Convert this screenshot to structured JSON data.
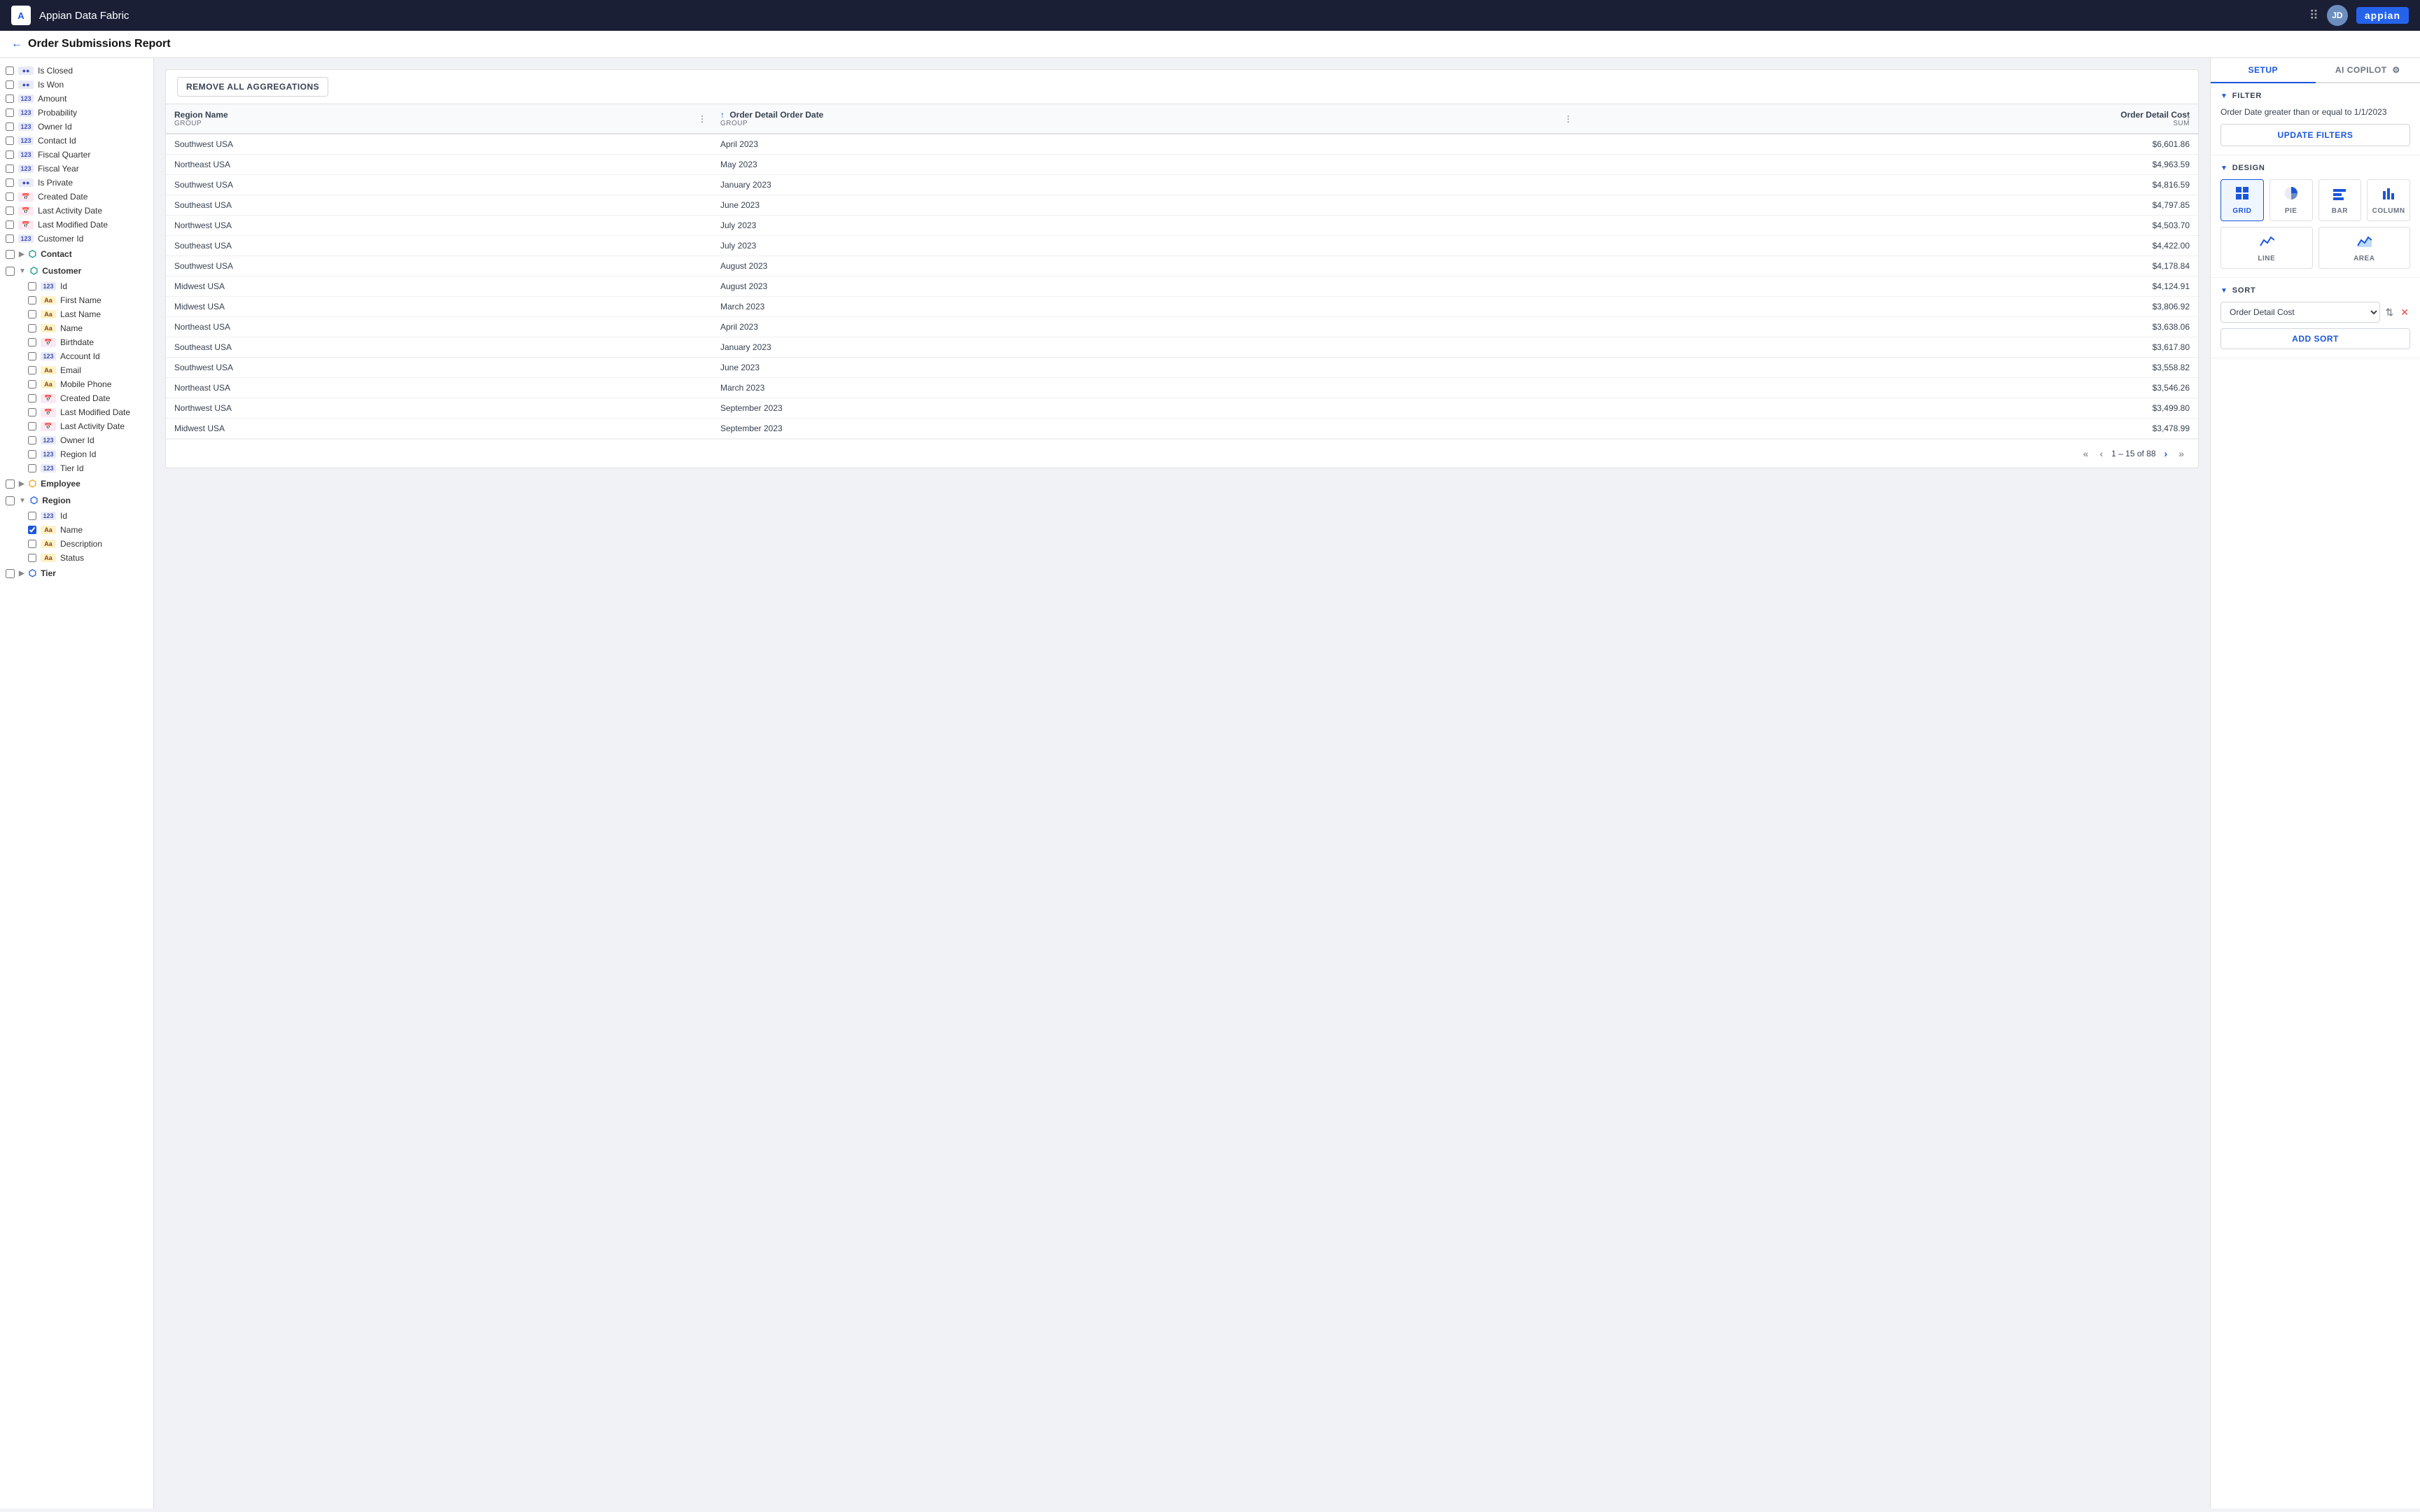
{
  "app": {
    "logo_text": "A",
    "title": "Appian Data Fabric",
    "brand": "appian",
    "user_initials": "JD"
  },
  "page": {
    "back_label": "←",
    "title": "Order Submissions Report"
  },
  "sidebar": {
    "fields": [
      {
        "id": "is-closed",
        "label": "Is Closed",
        "type": "bool",
        "checked": false,
        "indent": 0
      },
      {
        "id": "is-won",
        "label": "Is Won",
        "type": "bool",
        "checked": false,
        "indent": 0
      },
      {
        "id": "amount",
        "label": "Amount",
        "type": "123",
        "checked": false,
        "indent": 0
      },
      {
        "id": "probability",
        "label": "Probability",
        "type": "123",
        "checked": false,
        "indent": 0
      },
      {
        "id": "owner-id",
        "label": "Owner Id",
        "type": "123",
        "checked": false,
        "indent": 0
      },
      {
        "id": "contact-id",
        "label": "Contact Id",
        "type": "123",
        "checked": false,
        "indent": 0
      },
      {
        "id": "fiscal-quarter",
        "label": "Fiscal Quarter",
        "type": "123",
        "checked": false,
        "indent": 0
      },
      {
        "id": "fiscal-year",
        "label": "Fiscal Year",
        "type": "123",
        "checked": false,
        "indent": 0
      },
      {
        "id": "is-private",
        "label": "Is Private",
        "type": "bool",
        "checked": false,
        "indent": 0
      },
      {
        "id": "created-date",
        "label": "Created Date",
        "type": "date",
        "checked": false,
        "indent": 0
      },
      {
        "id": "last-activity-date",
        "label": "Last Activity Date",
        "type": "date",
        "checked": false,
        "indent": 0
      },
      {
        "id": "last-modified-date",
        "label": "Last Modified Date",
        "type": "date",
        "checked": false,
        "indent": 0
      },
      {
        "id": "customer-id",
        "label": "Customer Id",
        "type": "123",
        "checked": false,
        "indent": 0
      }
    ],
    "contact_group": {
      "label": "Contact",
      "expanded": false,
      "color": "teal"
    },
    "customer_group": {
      "label": "Customer",
      "expanded": true,
      "color": "teal",
      "fields": [
        {
          "id": "cust-id",
          "label": "Id",
          "type": "123",
          "checked": false
        },
        {
          "id": "cust-firstname",
          "label": "First Name",
          "type": "abc",
          "checked": false
        },
        {
          "id": "cust-lastname",
          "label": "Last Name",
          "type": "abc",
          "checked": false
        },
        {
          "id": "cust-name",
          "label": "Name",
          "type": "abc",
          "checked": false
        },
        {
          "id": "cust-birthdate",
          "label": "Birthdate",
          "type": "date",
          "checked": false
        },
        {
          "id": "cust-account-id",
          "label": "Account Id",
          "type": "123",
          "checked": false
        },
        {
          "id": "cust-email",
          "label": "Email",
          "type": "abc",
          "checked": false
        },
        {
          "id": "cust-mobile",
          "label": "Mobile Phone",
          "type": "abc",
          "checked": false
        },
        {
          "id": "cust-created",
          "label": "Created Date",
          "type": "date",
          "checked": false
        },
        {
          "id": "cust-modified",
          "label": "Last Modified Date",
          "type": "date",
          "checked": false
        },
        {
          "id": "cust-activity",
          "label": "Last Activity Date",
          "type": "date",
          "checked": false
        },
        {
          "id": "cust-owner",
          "label": "Owner Id",
          "type": "123",
          "checked": false
        },
        {
          "id": "cust-region",
          "label": "Region Id",
          "type": "123",
          "checked": false
        },
        {
          "id": "cust-tier",
          "label": "Tier Id",
          "type": "123",
          "checked": false
        }
      ]
    },
    "employee_group": {
      "label": "Employee",
      "expanded": false,
      "color": "orange"
    },
    "region_group": {
      "label": "Region",
      "expanded": true,
      "color": "blue",
      "fields": [
        {
          "id": "reg-id",
          "label": "Id",
          "type": "123",
          "checked": false
        },
        {
          "id": "reg-name",
          "label": "Name",
          "type": "abc",
          "checked": true
        },
        {
          "id": "reg-desc",
          "label": "Description",
          "type": "abc",
          "checked": false
        },
        {
          "id": "reg-status",
          "label": "Status",
          "type": "abc",
          "checked": false
        }
      ]
    },
    "tier_group": {
      "label": "Tier",
      "expanded": false,
      "color": "blue"
    }
  },
  "toolbar": {
    "remove_agg_label": "REMOVE ALL AGGREGATIONS"
  },
  "table": {
    "columns": [
      {
        "label": "Region Name",
        "subtitle": "GROUP",
        "has_menu": true,
        "has_sort": false
      },
      {
        "label": "Order Detail Order Date",
        "subtitle": "GROUP",
        "has_menu": true,
        "has_sort": true
      },
      {
        "label": "Order Detail Cost",
        "subtitle": "SUM",
        "has_menu": true,
        "has_sort": false
      }
    ],
    "rows": [
      {
        "region": "Southwest USA",
        "date": "April 2023",
        "cost": "$6,601.86"
      },
      {
        "region": "Northeast USA",
        "date": "May 2023",
        "cost": "$4,963.59"
      },
      {
        "region": "Southwest USA",
        "date": "January 2023",
        "cost": "$4,816.59"
      },
      {
        "region": "Southeast USA",
        "date": "June 2023",
        "cost": "$4,797.85"
      },
      {
        "region": "Northwest USA",
        "date": "July 2023",
        "cost": "$4,503.70"
      },
      {
        "region": "Southeast USA",
        "date": "July 2023",
        "cost": "$4,422.00"
      },
      {
        "region": "Southwest USA",
        "date": "August 2023",
        "cost": "$4,178.84"
      },
      {
        "region": "Midwest USA",
        "date": "August 2023",
        "cost": "$4,124.91"
      },
      {
        "region": "Midwest USA",
        "date": "March 2023",
        "cost": "$3,806.92"
      },
      {
        "region": "Northeast USA",
        "date": "April 2023",
        "cost": "$3,638.06"
      },
      {
        "region": "Southeast USA",
        "date": "January 2023",
        "cost": "$3,617.80"
      },
      {
        "region": "Southwest USA",
        "date": "June 2023",
        "cost": "$3,558.82"
      },
      {
        "region": "Northeast USA",
        "date": "March 2023",
        "cost": "$3,546.26"
      },
      {
        "region": "Northwest USA",
        "date": "September 2023",
        "cost": "$3,499.80"
      },
      {
        "region": "Midwest USA",
        "date": "September 2023",
        "cost": "$3,478.99"
      }
    ],
    "pagination": {
      "current_range": "1 – 15 of 88"
    }
  },
  "right_panel": {
    "tabs": [
      {
        "id": "setup",
        "label": "SETUP",
        "active": true
      },
      {
        "id": "ai-copilot",
        "label": "AI COPILOT",
        "active": false
      }
    ],
    "filter_section": {
      "header": "FILTER",
      "description": "Order Date greater than or equal to 1/1/2023",
      "update_btn": "UPDATE FILTERS"
    },
    "design_section": {
      "header": "DESIGN",
      "options": [
        {
          "id": "grid",
          "label": "GRID",
          "selected": true,
          "icon": "grid"
        },
        {
          "id": "pie",
          "label": "PIE",
          "selected": false,
          "icon": "pie"
        },
        {
          "id": "bar",
          "label": "BAR",
          "selected": false,
          "icon": "bar"
        },
        {
          "id": "column",
          "label": "COLUMN",
          "selected": false,
          "icon": "column"
        },
        {
          "id": "line",
          "label": "LINE",
          "selected": false,
          "icon": "line"
        },
        {
          "id": "area",
          "label": "AREA",
          "selected": false,
          "icon": "area"
        }
      ]
    },
    "sort_section": {
      "header": "SORT",
      "current_sort": "Order Detail Cost",
      "add_sort_btn": "ADD SORT"
    }
  }
}
